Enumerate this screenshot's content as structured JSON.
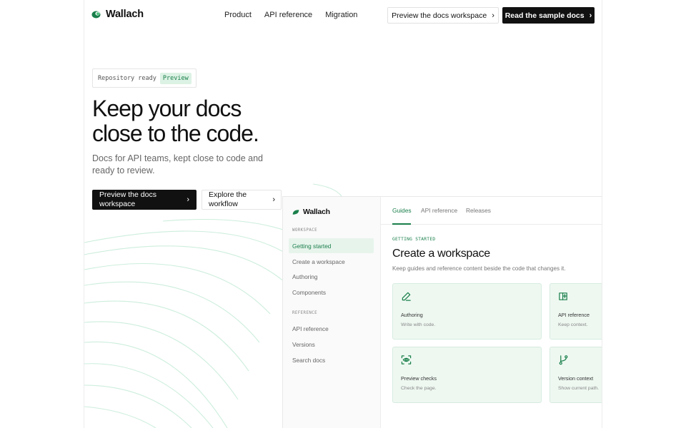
{
  "brand": {
    "name": "Wallach",
    "color": "#1a7f4b",
    "icon": "leaf-logo-icon"
  },
  "nav": {
    "links": [
      "Product",
      "API reference",
      "Migration"
    ],
    "secondary_cta": "Preview the docs workspace",
    "primary_cta": "Read the sample docs"
  },
  "hero": {
    "badge_text": "Repository ready",
    "badge_pill": "Preview",
    "title_line1": "Keep your docs",
    "title_line2": "close to the code.",
    "subtitle": "Docs for API teams, kept close to code and ready to review.",
    "primary_button": "Preview the docs workspace",
    "secondary_button": "Explore the workflow"
  },
  "docs": {
    "sidebar": {
      "brand": "Wallach",
      "section_workspace": "WORKSPACE",
      "workspace_items": [
        "Getting started",
        "Create a workspace",
        "Authoring",
        "Components"
      ],
      "active_item": "Getting started",
      "section_reference": "REFERENCE",
      "reference_items": [
        "API reference",
        "Versions",
        "Search docs"
      ]
    },
    "tabs": [
      "Guides",
      "API reference",
      "Releases"
    ],
    "active_tab": "Guides",
    "eyebrow": "GETTING STARTED",
    "title": "Create a workspace",
    "subtitle": "Keep guides and reference content beside the code that changes it.",
    "cards": [
      {
        "title": "Authoring",
        "desc": "Write with code.",
        "icon": "pencil-icon"
      },
      {
        "title": "API reference",
        "desc": "Keep context.",
        "icon": "book-icon"
      },
      {
        "title": "Preview checks",
        "desc": "Check the page.",
        "icon": "eye-scan-icon"
      },
      {
        "title": "Version context",
        "desc": "Show current path.",
        "icon": "git-branch-icon"
      }
    ]
  },
  "colors": {
    "accent": "#1a7f4b",
    "accent_soft": "#eef8f1",
    "arc": "#cdeedd",
    "dark": "#111111"
  }
}
